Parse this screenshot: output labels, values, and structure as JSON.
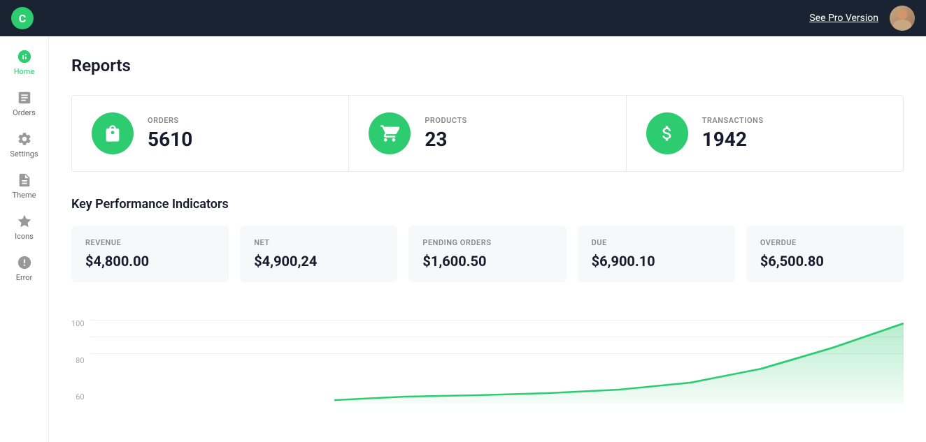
{
  "topNav": {
    "logoText": "C",
    "seeProLabel": "See Pro Version",
    "avatarAlt": "User avatar"
  },
  "sidebar": {
    "items": [
      {
        "id": "home",
        "label": "Home",
        "active": true
      },
      {
        "id": "orders",
        "label": "Orders",
        "active": false
      },
      {
        "id": "settings",
        "label": "Settings",
        "active": false
      },
      {
        "id": "theme",
        "label": "Theme",
        "active": false
      },
      {
        "id": "icons",
        "label": "Icons",
        "active": false
      },
      {
        "id": "error",
        "label": "Error",
        "active": false
      }
    ]
  },
  "page": {
    "title": "Reports"
  },
  "stats": [
    {
      "id": "orders",
      "label": "ORDERS",
      "value": "5610",
      "icon": "bag"
    },
    {
      "id": "products",
      "label": "PRODUCTS",
      "value": "23",
      "icon": "cart"
    },
    {
      "id": "transactions",
      "label": "TRANSACTIONS",
      "value": "1942",
      "icon": "dollar"
    }
  ],
  "kpi": {
    "title": "Key Performance Indicators",
    "cards": [
      {
        "id": "revenue",
        "label": "REVENUE",
        "value": "$4,800.00"
      },
      {
        "id": "net",
        "label": "NET",
        "value": "$4,900,24"
      },
      {
        "id": "pending-orders",
        "label": "PENDING ORDERS",
        "value": "$1,600.50"
      },
      {
        "id": "due",
        "label": "DUE",
        "value": "$6,900.10"
      },
      {
        "id": "overdue",
        "label": "OVERDUE",
        "value": "$6,500.80"
      }
    ]
  },
  "chart": {
    "yLabels": [
      "100",
      "80",
      "60"
    ],
    "colors": {
      "line": "#2ecc71",
      "fill": "rgba(46,204,113,0.2)"
    }
  }
}
